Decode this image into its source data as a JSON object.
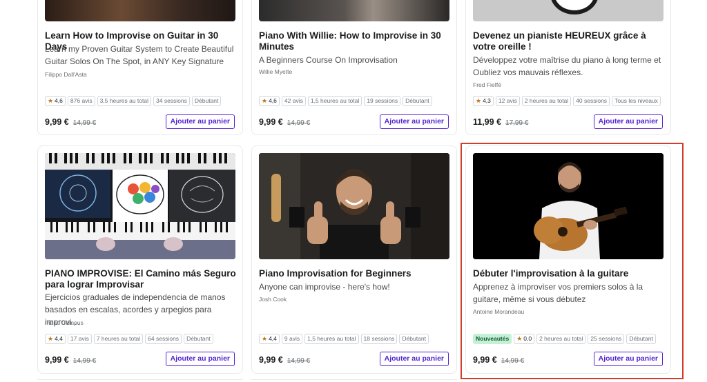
{
  "row1": [
    {
      "title": "Learn How to Improvise on Guitar in 30 Days",
      "subtitle": "Learn my Proven Guitar System to Create Beautiful Guitar Solos On The Spot, in ANY Key Signature",
      "author": "Filippo Dall'Asta",
      "rating": "4,6",
      "reviews": "876 avis",
      "hours": "3,5 heures au total",
      "sessions": "34 sessions",
      "level": "Débutant",
      "price": "9,99 €",
      "old_price": "14,99 €",
      "cart_label": "Ajouter au panier"
    },
    {
      "title": "Piano With Willie: How to Improvise in 30 Minutes",
      "subtitle": "A Beginners Course On Improvisation",
      "author": "Willie Myette",
      "rating": "4,6",
      "reviews": "42 avis",
      "hours": "1,5 heures au total",
      "sessions": "19 sessions",
      "level": "Débutant",
      "price": "9,99 €",
      "old_price": "14,99 €",
      "cart_label": "Ajouter au panier"
    },
    {
      "title": "Devenez un pianiste HEUREUX grâce à votre oreille !",
      "subtitle": "Développez votre maîtrise du piano à long terme et Oubliez vos mauvais réflexes.",
      "author": "Fred Fieffé",
      "rating": "4,3",
      "reviews": "12 avis",
      "hours": "2 heures au total",
      "sessions": "40 sessions",
      "level": "Tous les niveaux",
      "price": "11,99 €",
      "old_price": "17,99 €",
      "cart_label": "Ajouter au panier"
    }
  ],
  "row2": [
    {
      "title": "PIANO IMPROVISE: El Camino más Seguro para lograr Improvisar",
      "subtitle": "Ejercicios graduales de independencia de manos basados en escalas, acordes y arpegios para improvi…",
      "author": "Piano Campus",
      "rating": "4,4",
      "reviews": "17 avis",
      "hours": "7 heures au total",
      "sessions": "64 sessions",
      "level": "Débutant",
      "price": "9,99 €",
      "old_price": "14,99 €",
      "cart_label": "Ajouter au panier"
    },
    {
      "title": "Piano Improvisation for Beginners",
      "subtitle": "Anyone can improvise - here's how!",
      "author": "Josh Cook",
      "rating": "4,4",
      "reviews": "9 avis",
      "hours": "1,5 heures au total",
      "sessions": "18 sessions",
      "level": "Débutant",
      "price": "9,99 €",
      "old_price": "14,99 €",
      "cart_label": "Ajouter au panier"
    },
    {
      "title": "Débuter l'improvisation à la guitare",
      "subtitle": "Apprenez à improviser vos premiers solos à la guitare, même si vous débutez",
      "author": "Antoine Morandeau",
      "new_badge": "Nouveautés",
      "rating": "0,0",
      "hours": "2 heures au total",
      "sessions": "25 sessions",
      "level": "Débutant",
      "price": "9,99 €",
      "old_price": "14,99 €",
      "cart_label": "Ajouter au panier"
    }
  ],
  "colors": {
    "accent": "#5624d0",
    "star": "#c4710d",
    "new_badge_bg": "#c5f0d6",
    "highlight": "#d43b2a"
  },
  "icons": {
    "rating": "star-icon"
  }
}
